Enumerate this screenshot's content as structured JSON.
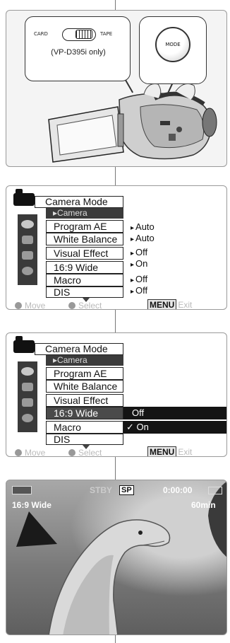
{
  "panel1": {
    "switch_left": "CARD",
    "switch_right": "TAPE",
    "note": "(VP-D395i only)",
    "mode_button": "MODE"
  },
  "panel2": {
    "title": "Camera Mode",
    "subtitle": "▸Camera",
    "items": [
      "Program AE",
      "White Balance",
      "Visual Effect",
      "16:9 Wide",
      "Macro",
      "DIS"
    ],
    "values": [
      "Auto",
      "Auto",
      "Off",
      "On",
      "Off",
      "Off"
    ],
    "move": "Move",
    "select": "Select",
    "menu_key": "MENU",
    "exit": "Exit"
  },
  "panel3": {
    "title": "Camera Mode",
    "subtitle": "▸Camera",
    "items": [
      "Program AE",
      "White Balance",
      "Visual Effect",
      "16:9 Wide",
      "Macro",
      "DIS"
    ],
    "selected_item": "16:9 Wide",
    "options": [
      "Off",
      "✓ On"
    ],
    "move": "Move",
    "select": "Select",
    "menu_key": "MENU",
    "exit": "Exit"
  },
  "panel4": {
    "stby": "STBY",
    "sp": "SP",
    "time": "0:00:00",
    "remaining": "60min",
    "mode_label": "16:9 Wide"
  }
}
